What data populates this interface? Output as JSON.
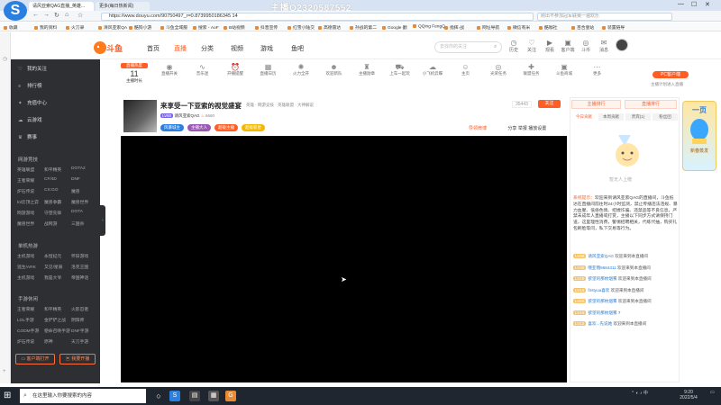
{
  "browser": {
    "tabs": [
      "请风亚索QAG直播_英雄...",
      "更多(每日热新闻)"
    ],
    "watermark": "主播Q2320587552",
    "url": "https://www.douyu.com/90750497_r=0.8739950186345 14",
    "search_placeholder": "刚出不参加冠军联赛一遍欢乐",
    "bookmarks": [
      "收藏",
      "我的资料",
      "火刀录",
      "清风亚索QA",
      "酷狗小游",
      "斗鱼全域服",
      "搜索 - AoF",
      "B站视频",
      "抖音宣传",
      "红雪小陆交",
      "高德雷达",
      "孙战的第二",
      "Google 翻",
      "QQing FengQ",
      "指挥-战",
      "网址导航",
      "微信有米",
      "酷咖社",
      "百合壹站",
      "装置链导"
    ]
  },
  "site": {
    "nav": [
      "首页",
      "直播",
      "分类",
      "视频",
      "游戏",
      "鱼吧"
    ],
    "search_placeholder": "去找你的关注",
    "header_icons": [
      "历史",
      "关注",
      "观看",
      "客户端",
      "斗币",
      "消息"
    ]
  },
  "sidebar": {
    "main_items": [
      {
        "icon": "heart-icon",
        "label": "我的关注"
      },
      {
        "icon": "list-icon",
        "label": "排行榜"
      },
      {
        "icon": "gift-icon",
        "label": "充值中心"
      },
      {
        "icon": "cloud-icon",
        "label": "云游戏"
      },
      {
        "icon": "trophy-icon",
        "label": "赛事"
      }
    ],
    "section_online": "网游竞技",
    "online_links": [
      [
        "英雄联盟",
        "和平精英",
        "DOTA2"
      ],
      [
        "王者荣耀",
        "CF/4D",
        "DNF"
      ],
      [
        "炉石传说",
        "CS:GO",
        "魔兽"
      ],
      [
        "lol云顶之弈",
        "魔兽争霸",
        "魔兽世界"
      ],
      [
        "网游游戏",
        "守望先锋",
        "DOTA"
      ],
      [
        "魔兽世界",
        "战网游",
        "三国杀"
      ]
    ],
    "section_single": "单机热游",
    "single_links": [
      [
        "主机游戏",
        "永恒纪元",
        "怀旧游戏"
      ],
      [
        "逃生/ARK",
        "又见/星辰",
        "洛克王国"
      ],
      [
        "主机游戏",
        "我是大爷",
        "帝国神话"
      ]
    ],
    "section_mobile": "手游休闲",
    "mobile_links": [
      [
        "王者荣耀",
        "和平精英",
        "火影忍者"
      ],
      [
        "LOL手游",
        "金铲铲之战",
        "阴阳师"
      ],
      [
        "CODM手游",
        "使命召唤手游",
        "DNF手游"
      ],
      [
        "炉石传说",
        "原神",
        "天刀手游"
      ]
    ],
    "download_btn": "客户端打开",
    "live_btn": "我要开播"
  },
  "category_strip": {
    "hot_label": "直播热度",
    "hot_value": "11",
    "hot_caption": "主播时长",
    "items": [
      "直播开关",
      "音乐迷",
      "开播提醒",
      "直播日历",
      "火力全开",
      "欢迎新队",
      "主播勋章",
      "上车一起玩",
      "小飞机云蝶",
      "主页",
      "光荣任务",
      "联盟任务",
      "斗鱼商城",
      "更多"
    ],
    "pc_badge": "PC客户端",
    "pc_caption": "主播计划进入直播"
  },
  "room": {
    "title": "来享受一下亚索的视觉盛宴",
    "tags": "英雄 · 网游竞技 · 英雄联盟 · 大神解说",
    "anchor": "请风亚索QAG",
    "level": "LV80",
    "fans_count": "6660",
    "badges": [
      "风暴城主",
      "主播大人",
      "超级主播",
      "超级新星"
    ],
    "online_count": "35443",
    "follow_label": "关注",
    "actions": [
      "导领微博",
      "分享",
      "举报",
      "播放设置"
    ]
  },
  "chat": {
    "tabs": [
      "今日贡献",
      "本周贡献",
      "贵宾(1)",
      "粉丝团"
    ],
    "notice_prefix": "系统提示：",
    "notice_text": "欢迎来到请风亚索QAG的直播间，斗鱼抵达在直播间前往时24小时监测，禁止传播违法违规、暴力血腥、低俗色情、招嫖诈骗、违禁品等不良信息，严禁未成年人直播或打赏，主播以下同步方式请保持门道，这里理性消费，警惕招聘相关，代练代抽，购买礼包刷脸等问，私下交易等行为。",
    "messages": [
      {
        "lv": "LV36",
        "name": "请风亚索QAG",
        "text": "欢迎来到本直播间"
      },
      {
        "lv": "LV35",
        "name": "哦亚哦9684311",
        "text": "欢迎来到本直播间"
      },
      {
        "lv": "LV15",
        "name": "欲望的那枚烟雾",
        "text": "欢迎来到本直播间"
      },
      {
        "lv": "LV18",
        "name": "firstyua喜欢",
        "text": "欢迎来到本直播间"
      },
      {
        "lv": "LV20",
        "name": "欲望的那枚烟雾",
        "text": "欢迎来到本直播间"
      },
      {
        "lv": "LV16",
        "name": "欲望的那枚烟雾",
        "text": "7"
      },
      {
        "lv": "LV12",
        "name": "喜欢...先说她",
        "text": "欢迎来到本直播间"
      }
    ]
  },
  "floating_badge": {
    "title": "一页",
    "caption": "新春蒸发"
  },
  "taskbar": {
    "search_placeholder": "在这里输入你要搜索的内容",
    "time": "9:20",
    "date": "2022/5/4",
    "tray_text": "中"
  },
  "colors": {
    "accent": "#ff5d23",
    "sidebar": "#2d2f33",
    "taskbar": "#1f2630"
  }
}
